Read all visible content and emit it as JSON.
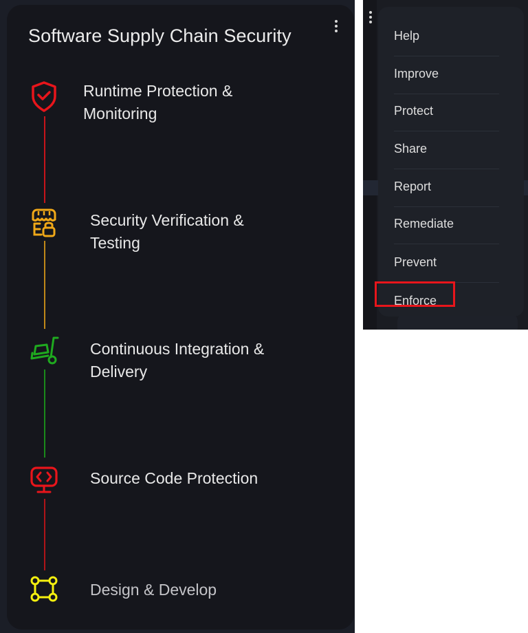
{
  "card": {
    "title": "Software Supply Chain Security",
    "more_options_icon": "vertical-ellipsis-icon",
    "steps": [
      {
        "label_line1": "Runtime Protection &",
        "label_line2": "Monitoring",
        "icon": "shield-check-icon",
        "color": "#e8151b"
      },
      {
        "label_line1": "Security Verification &",
        "label_line2": "Testing",
        "icon": "store-lock-icon",
        "color": "#f0a818"
      },
      {
        "label_line1": "Continuous Integration &",
        "label_line2": "Delivery",
        "icon": "hand-truck-icon",
        "color": "#1faa1f"
      },
      {
        "label_line1": "Source Code Protection",
        "label_line2": "",
        "icon": "code-monitor-icon",
        "color": "#e8151b"
      },
      {
        "label_line1": "Design & Develop",
        "label_line2": "",
        "icon": "nodes-square-icon",
        "color": "#f5f00f"
      }
    ]
  },
  "menu": {
    "items": [
      "Help",
      "Improve",
      "Protect",
      "Share",
      "Report",
      "Remediate",
      "Prevent",
      "Enforce"
    ],
    "highlighted": "Enforce",
    "highlight_color": "#e8151b"
  }
}
